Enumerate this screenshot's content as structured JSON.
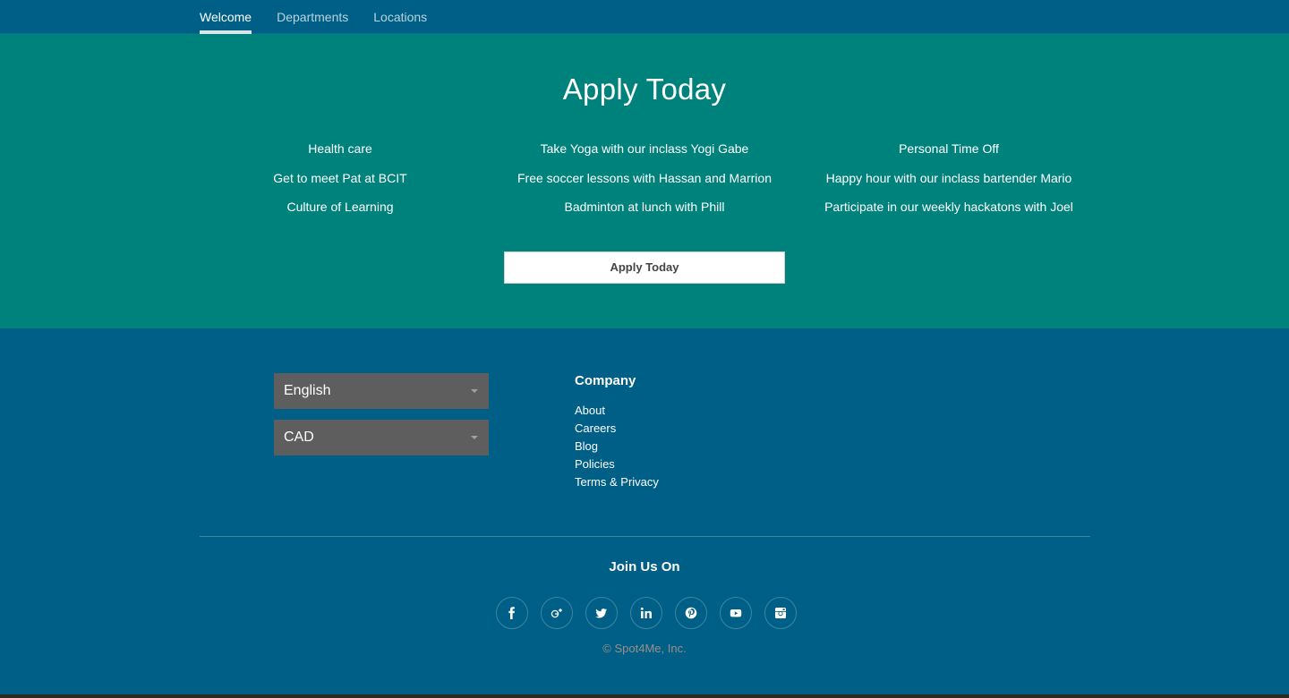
{
  "nav": {
    "tabs": [
      {
        "label": "Welcome",
        "active": true
      },
      {
        "label": "Departments",
        "active": false
      },
      {
        "label": "Locations",
        "active": false
      }
    ]
  },
  "hero": {
    "title": "Apply Today",
    "perks": [
      [
        "Health care",
        "Get to meet Pat at BCIT",
        "Culture of Learning"
      ],
      [
        "Take Yoga with our inclass Yogi Gabe",
        "Free soccer lessons with Hassan and Marrion",
        "Badminton at lunch with Phill"
      ],
      [
        "Personal Time Off",
        "Happy hour with our inclass bartender Mario",
        "Participate in our weekly hackatons with Joel"
      ]
    ],
    "button_label": "Apply Today"
  },
  "footer": {
    "language_select": "English",
    "currency_select": "CAD",
    "company_title": "Company",
    "company_links": [
      "About",
      "Careers",
      "Blog",
      "Policies",
      "Terms & Privacy"
    ],
    "join_title": "Join Us On",
    "socials": [
      "facebook-icon",
      "google-plus-icon",
      "twitter-icon",
      "linkedin-icon",
      "pinterest-icon",
      "youtube-icon",
      "instagram-icon"
    ],
    "copyright": "© Spot4Me, Inc."
  },
  "colors": {
    "nav_bg": "#005f86",
    "hero_bg": "#00827c",
    "footer_bg": "#005f86",
    "select_bg": "#5e5e5e"
  }
}
